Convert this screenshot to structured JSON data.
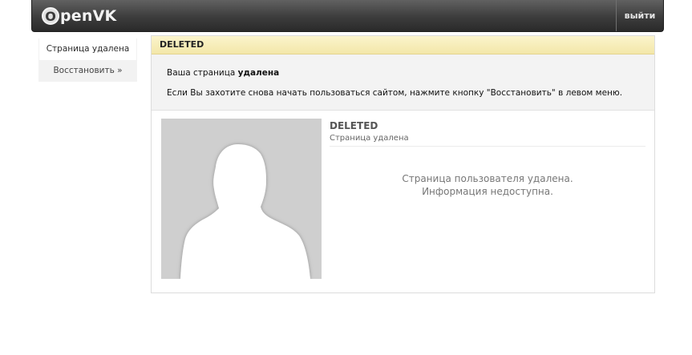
{
  "header": {
    "logo_letter": "O",
    "logo_text": "penVK",
    "logout_label": "выйти"
  },
  "sidebar": {
    "items": [
      {
        "label": "Страница удалена"
      },
      {
        "label": "Восстановить »"
      }
    ]
  },
  "panel": {
    "title": "DELETED",
    "notice": {
      "line1_prefix": "Ваша страница ",
      "line1_bold": "удалена",
      "line2": "Если Вы захотите снова начать пользоваться сайтом, нажмите кнопку \"Восстановить\" в левом меню."
    },
    "profile": {
      "name": "DELETED",
      "status": "Страница удалена",
      "message_line1": "Страница пользователя удалена.",
      "message_line2": "Информация недоступна."
    }
  },
  "colors": {
    "header_bg": "#3c3c3c",
    "title_bar": "#f3e7a9",
    "avatar_bg": "#cfcfcf"
  }
}
